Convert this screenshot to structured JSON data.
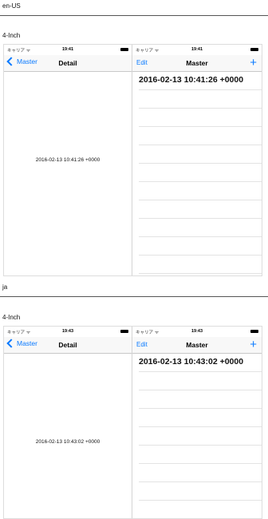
{
  "sections": [
    {
      "language": "en-US",
      "device": "4-Inch",
      "status": {
        "carrier": "キャリア",
        "time": "19:41"
      },
      "detail": {
        "back_label": "Master",
        "title": "Detail",
        "text": "2016-02-13 10:41:26 +0000"
      },
      "master": {
        "edit_label": "Edit",
        "title": "Master",
        "add_label": "+",
        "rows": [
          "2016-02-13 10:41:26 +0000"
        ]
      }
    },
    {
      "language": "ja",
      "device": "4-Inch",
      "status": {
        "carrier": "キャリア",
        "time": "19:43"
      },
      "detail": {
        "back_label": "Master",
        "title": "Detail",
        "text": "2016-02-13 10:43:02 +0000"
      },
      "master": {
        "edit_label": "Edit",
        "title": "Master",
        "add_label": "+",
        "rows": [
          "2016-02-13 10:43:02 +0000"
        ]
      }
    }
  ],
  "icons": {
    "wifi": "wifi-icon",
    "battery": "battery-icon",
    "back": "chevron-left-icon",
    "add": "plus-icon"
  },
  "colors": {
    "tint": "#0a7aff",
    "separator": "#e3e3e3"
  }
}
